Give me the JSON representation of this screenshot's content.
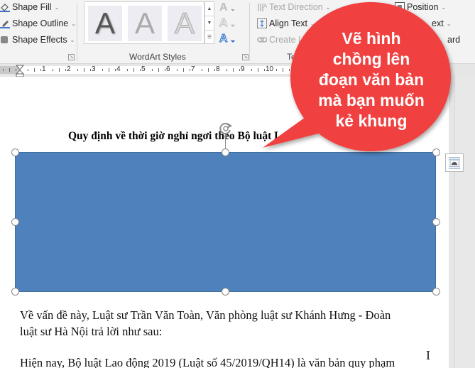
{
  "ribbon": {
    "shape_styles": {
      "items": [
        {
          "label": "Shape Fill",
          "icon": "paint-bucket-icon"
        },
        {
          "label": "Shape Outline",
          "icon": "pen-outline-icon"
        },
        {
          "label": "Shape Effects",
          "icon": "shape-effects-icon"
        }
      ]
    },
    "wordart_styles": {
      "label": "WordArt Styles",
      "gallery": [
        "A",
        "A",
        "A"
      ],
      "side_buttons": [
        {
          "icon": "text-fill-icon",
          "glyph": "A"
        },
        {
          "icon": "text-outline-icon",
          "glyph": "A"
        },
        {
          "icon": "text-effects-icon",
          "glyph": "A"
        }
      ]
    },
    "text": {
      "label": "Te",
      "items": [
        {
          "label": "Text Direction",
          "disabled": true
        },
        {
          "label": "Align Text",
          "disabled": false
        },
        {
          "label": "Create Li",
          "disabled": true
        }
      ]
    },
    "arrange": {
      "items": [
        {
          "label": "Position"
        },
        {
          "label": "ext"
        },
        {
          "label": "ard"
        }
      ]
    }
  },
  "ruler": {
    "numbers": [
      "1",
      "2",
      "3",
      "4",
      "5",
      "6",
      "7",
      "8",
      "9",
      "10",
      "1"
    ]
  },
  "document": {
    "heading": "Quy định về thời giờ nghỉ ngơi theo Bộ luật Lao",
    "paragraphs": [
      "Về vấn đề này, Luật sư Trần Văn Toàn, Văn phòng luật sư Khánh Hưng - Đoàn",
      "luật sư Hà Nội trả lời như sau:",
      "Hiện nay, Bộ luật Lao động 2019 (Luật số 45/2019/QH14) là văn bản quy phạm"
    ]
  },
  "shape": {
    "fill_color": "#4f81bd",
    "border_color": "#41719c"
  },
  "callout": {
    "lines": [
      "Vẽ hình",
      "chồng lên",
      "đoạn văn bản",
      "mà bạn muốn",
      "kẻ khung"
    ],
    "color": "#f04040"
  },
  "layout_options": {
    "icon": "layout-options-icon"
  }
}
